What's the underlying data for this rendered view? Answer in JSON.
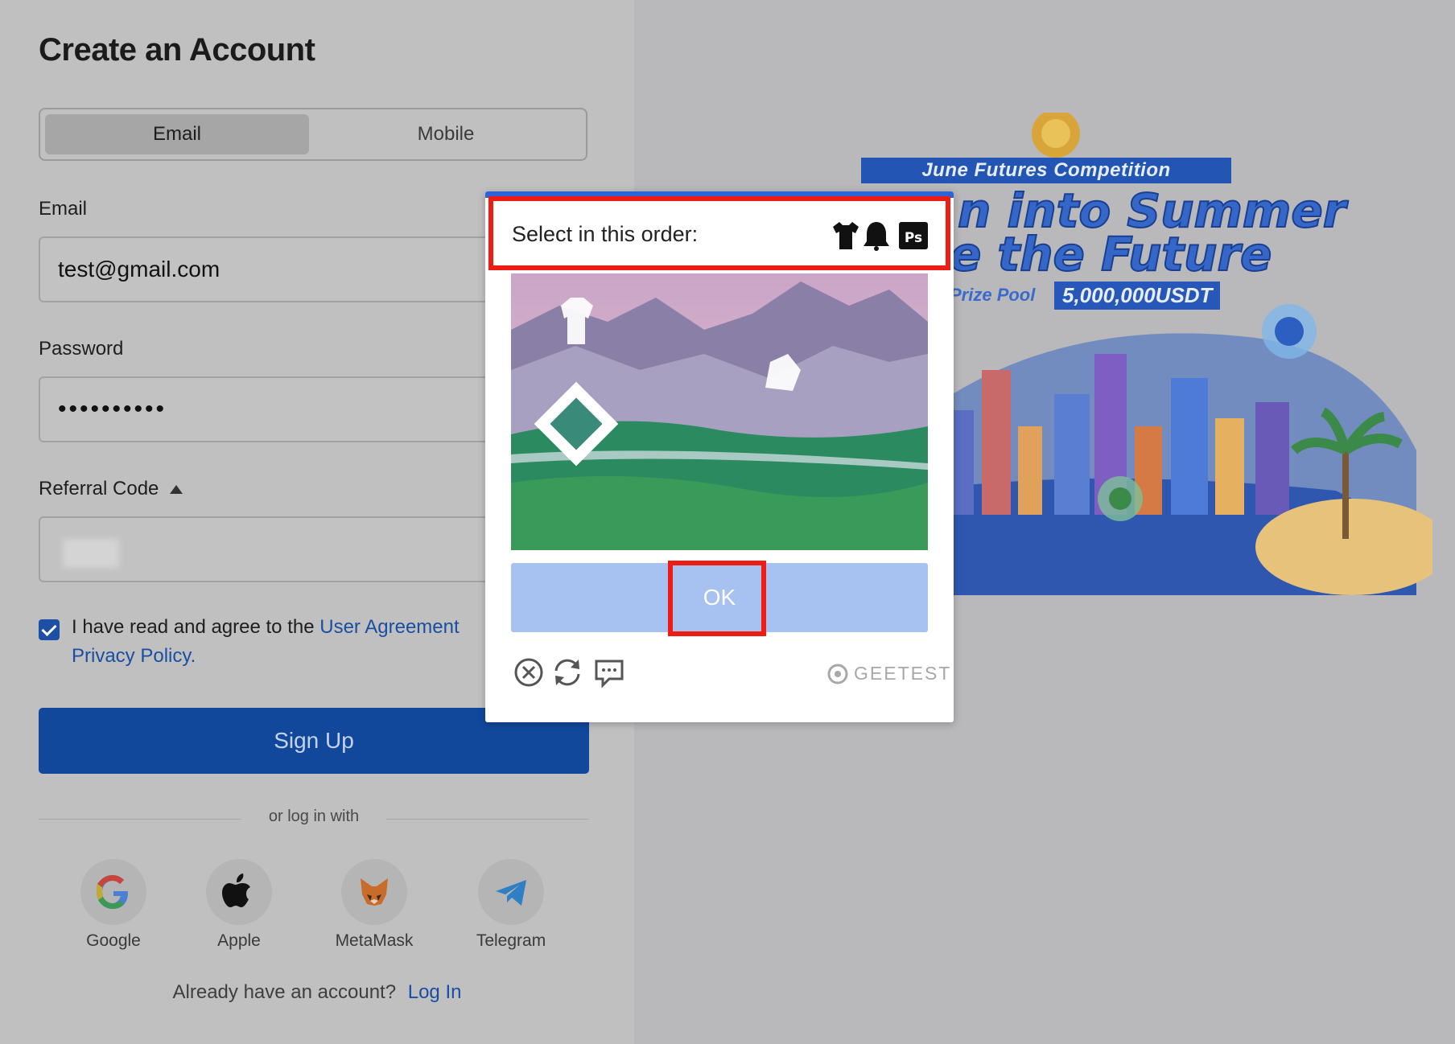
{
  "form": {
    "title": "Create an Account",
    "tabs": [
      {
        "label": "Email"
      },
      {
        "label": "Mobile"
      }
    ],
    "email_label": "Email",
    "email_value": "test@gmail.com",
    "password_label": "Password",
    "password_value": "••••••••••",
    "referral_label": "Referral Code",
    "agree_prefix": "I have read and agree to the",
    "user_agreement": "User Agreement",
    "privacy_policy": "Privacy Policy.",
    "signup_label": "Sign Up",
    "or_label": "or log in with",
    "social": [
      {
        "label": "Google",
        "icon": "google-icon"
      },
      {
        "label": "Apple",
        "icon": "apple-icon"
      },
      {
        "label": "MetaMask",
        "icon": "metamask-icon"
      },
      {
        "label": "Telegram",
        "icon": "telegram-icon"
      }
    ],
    "login_prompt": "Already have an account?",
    "login_link": "Log In"
  },
  "banner": {
    "competition": "June Futures Competition",
    "headline_1": "n into Summer",
    "headline_2": "e the Future",
    "prize_label": "Prize Pool",
    "prize_amount": "5,000,000USDT"
  },
  "captcha": {
    "instruction": "Select in this order:",
    "target_icons": [
      "tshirt-icon",
      "bell-icon",
      "photoshop-icon"
    ],
    "ok_label": "OK",
    "brand": "GEETEST",
    "tools": [
      "close-icon",
      "refresh-icon",
      "feedback-icon"
    ]
  },
  "colors": {
    "primary": "#11489c",
    "link": "#1a4ea3",
    "highlight": "#ee1c13",
    "captcha_button": "#a7c1f0"
  }
}
